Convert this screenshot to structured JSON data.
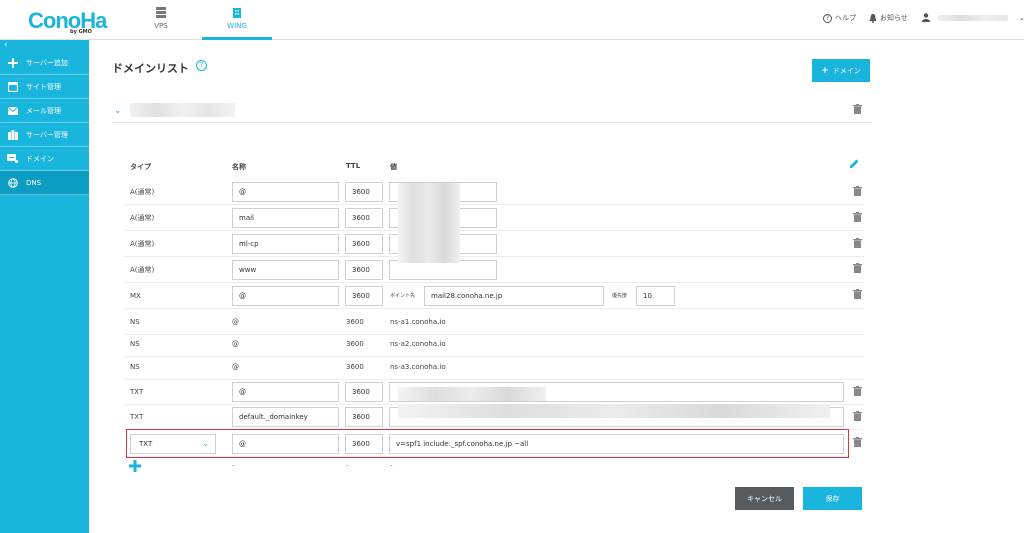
{
  "header": {
    "logo": "ConoHa",
    "logo_sub": "by GMO",
    "tabs": [
      {
        "label": "VPS"
      },
      {
        "label": "WING"
      }
    ],
    "help": "ヘルプ",
    "notice": "お知らせ"
  },
  "sidebar": {
    "collapse": "‹",
    "items": [
      {
        "label": "サーバー追加",
        "icon": "plus-icon"
      },
      {
        "label": "サイト管理",
        "icon": "window-icon"
      },
      {
        "label": "メール管理",
        "icon": "mail-icon"
      },
      {
        "label": "サーバー管理",
        "icon": "server-icon"
      },
      {
        "label": "ドメイン",
        "icon": "domain-icon"
      },
      {
        "label": "DNS",
        "icon": "globe-icon"
      }
    ]
  },
  "main": {
    "title": "ドメインリスト",
    "help_symbol": "?",
    "add_domain": "ドメイン"
  },
  "table": {
    "headers": {
      "type": "タイプ",
      "name": "名称",
      "ttl": "TTL",
      "value": "値"
    },
    "rows": [
      {
        "type": "A(通常)",
        "name": "@",
        "ttl": "3600"
      },
      {
        "type": "A(通常)",
        "name": "mail",
        "ttl": "3600"
      },
      {
        "type": "A(通常)",
        "name": "ml-cp",
        "ttl": "3600"
      },
      {
        "type": "A(通常)",
        "name": "www",
        "ttl": "3600"
      },
      {
        "type": "MX",
        "name": "@",
        "ttl": "3600",
        "point_label": "ポイント先",
        "point": "mail28.conoha.ne.jp",
        "priority_label": "優先度",
        "priority": "10"
      },
      {
        "type": "NS",
        "name": "@",
        "ttl": "3600",
        "value": "ns-a1.conoha.io"
      },
      {
        "type": "NS",
        "name": "@",
        "ttl": "3600",
        "value": "ns-a2.conoha.io"
      },
      {
        "type": "NS",
        "name": "@",
        "ttl": "3600",
        "value": "ns-a3.conoha.io"
      },
      {
        "type": "TXT",
        "name": "@",
        "ttl": "3600"
      },
      {
        "type": "TXT",
        "name": "default._domainkey",
        "ttl": "3600"
      },
      {
        "type": "TXT",
        "name": "@",
        "ttl": "3600",
        "value": "v=spf1 include:_spf.conoha.ne.jp ~all"
      }
    ],
    "add_row": {
      "name": "-",
      "ttl": "-",
      "value": "-"
    }
  },
  "buttons": {
    "cancel": "キャンセル",
    "save": "保存"
  },
  "colors": {
    "accent": "#19b5dc",
    "highlight": "#d9363e",
    "cancel": "#555b5e"
  }
}
